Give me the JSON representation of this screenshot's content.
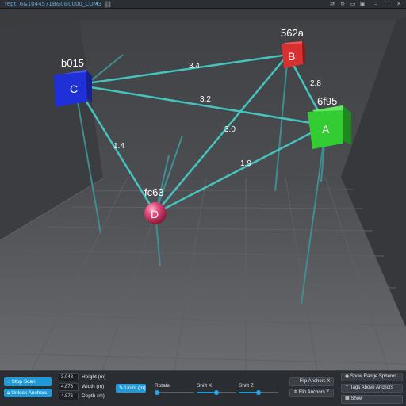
{
  "titlebar": {
    "title": "rept: 6&1044571B&0&0000_COM3",
    "icons": [
      "chevron-down-icon",
      "unlink-icon",
      "share-icon",
      "refresh-icon",
      "folder-icon",
      "save-icon"
    ],
    "window_buttons": {
      "minimize": "–",
      "maximize": "□",
      "close": "✕"
    }
  },
  "scene": {
    "colors": {
      "link": "#45c4bf",
      "anchor_a": "#33cc33",
      "anchor_b": "#d63030",
      "anchor_c": "#2030d8",
      "anchor_d": "#d63a6a",
      "pole": "#3f8e92"
    },
    "anchors": [
      {
        "letter": "A",
        "name": "6f95"
      },
      {
        "letter": "B",
        "name": "562a"
      },
      {
        "letter": "C",
        "name": "b015"
      },
      {
        "letter": "D",
        "name": "fc63"
      }
    ],
    "distances": {
      "C_B": "3.4",
      "C_A": "3.2",
      "C_D": "1.4",
      "B_A": "2.8",
      "B_D": "3.0",
      "A_D": "1.9"
    }
  },
  "controls": {
    "stop_scan": "Stop Scan",
    "unlock_anchors": "Unlock Anchors",
    "height_value": "3.048",
    "height_label": "Height (m)",
    "width_value": "4.876",
    "width_label": "Width (m)",
    "depth_value": "4.876",
    "depth_label": "Depth (m)",
    "units_button": "Units (m)",
    "rotate_label": "Rotate",
    "shift_x_label": "Shift X",
    "shift_z_label": "Shift Z",
    "rotate_fraction": 0.05,
    "shift_x_fraction": 0.5,
    "shift_z_fraction": 0.5,
    "flip_x": "Flip Anchors X",
    "flip_z": "Flip Anchors Z",
    "show_range": "Show Range Spheres",
    "tags_above": "Tags Above Anchors",
    "show": "Show"
  }
}
